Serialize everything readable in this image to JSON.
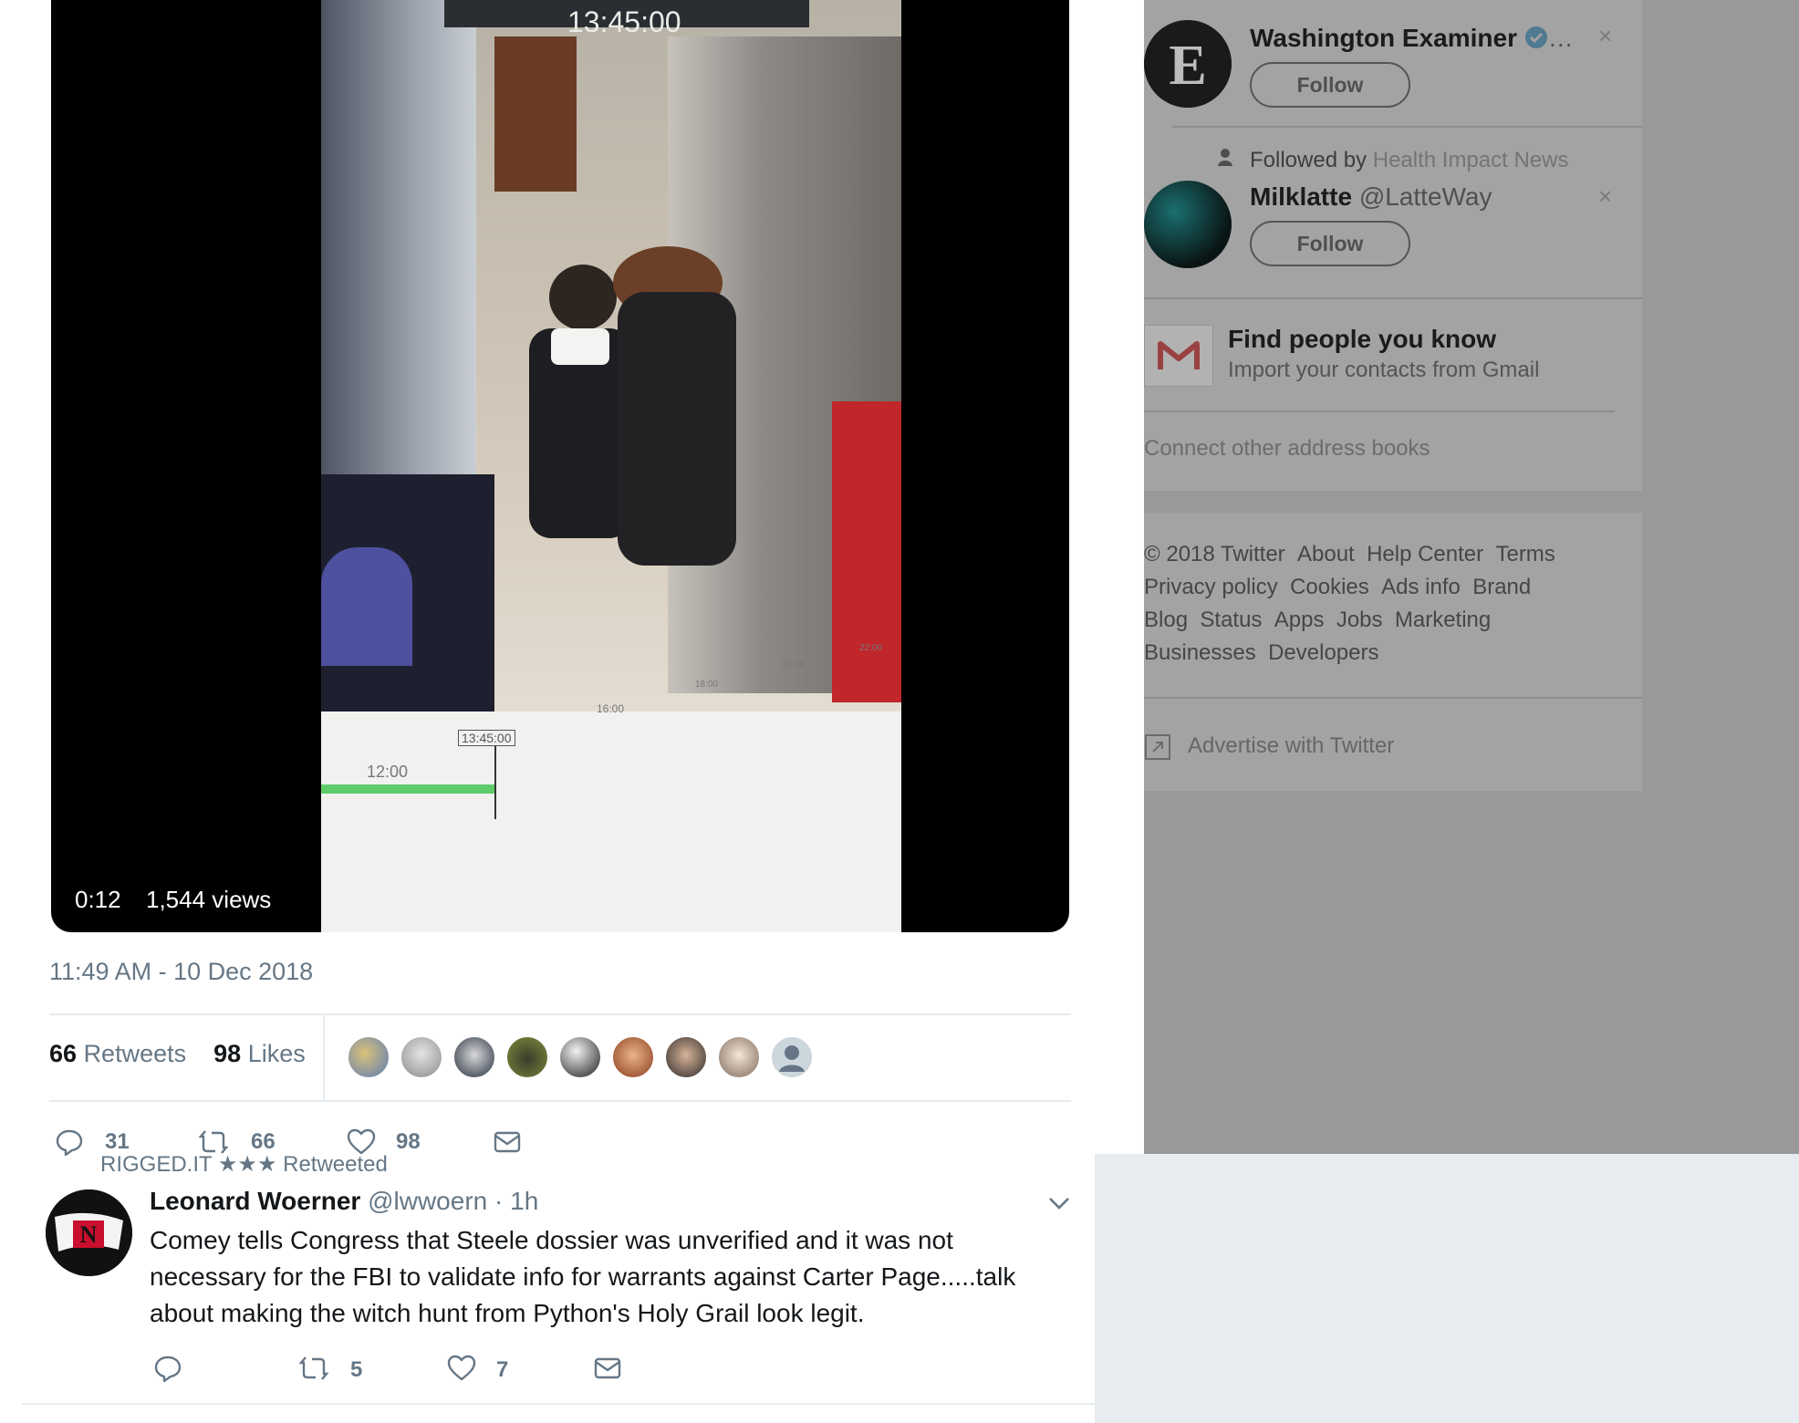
{
  "video": {
    "duration": "0:12",
    "views": "1,544 views",
    "overlay_timestamp": "13:45:00",
    "overlay_cursor_time": "13:45:00",
    "timeline_ticks": [
      "12:00",
      "16:00",
      "18:00",
      "20:00",
      "22:00"
    ]
  },
  "tweet": {
    "timestamp": "11:49 AM - 10 Dec 2018",
    "retweets_count": "66",
    "retweets_label": "Retweets",
    "likes_count": "98",
    "likes_label": "Likes",
    "actions": {
      "reply_count": "31",
      "retweet_count": "66",
      "like_count": "98"
    }
  },
  "next_tweet": {
    "context": "RIGGED.IT ★★★ Retweeted",
    "author_name": "Leonard Woerner",
    "author_handle": "@lwwoern",
    "time": "· 1h",
    "text": "Comey tells Congress that Steele dossier was unverified and it was not necessary for the FBI to validate info for warrants against Carter Page.....talk about making the witch hunt from Python's Holy Grail look legit.",
    "actions": {
      "retweet_count": "5",
      "like_count": "7"
    }
  },
  "sidebar": {
    "who_to_follow": [
      {
        "name": "Washington Examiner",
        "handle": "…",
        "follow_label": "Follow",
        "dismiss": "×",
        "avatar_letter": "E"
      },
      {
        "followed_by_prefix": "Followed by",
        "followed_by_name": "Health Impact News",
        "name": "Milklatte",
        "handle": "@LatteWay",
        "follow_label": "Follow",
        "dismiss": "×"
      }
    ],
    "find_people": {
      "title": "Find people you know",
      "subtitle": "Import your contacts from Gmail",
      "connect_other": "Connect other address books"
    },
    "footer_links": [
      [
        "© 2018 Twitter",
        "About",
        "Help Center",
        "Terms"
      ],
      [
        "Privacy policy",
        "Cookies",
        "Ads info",
        "Brand"
      ],
      [
        "Blog",
        "Status",
        "Apps",
        "Jobs",
        "Marketing"
      ],
      [
        "Businesses",
        "Developers"
      ]
    ],
    "advertise": "Advertise with Twitter"
  },
  "colors": {
    "twitter_gray": "#657786",
    "divider": "#e6ecf0",
    "overlay_gray": "#999999",
    "star": "#ffac33",
    "red_x": "#e0245e",
    "verified": "#1da1f2"
  }
}
